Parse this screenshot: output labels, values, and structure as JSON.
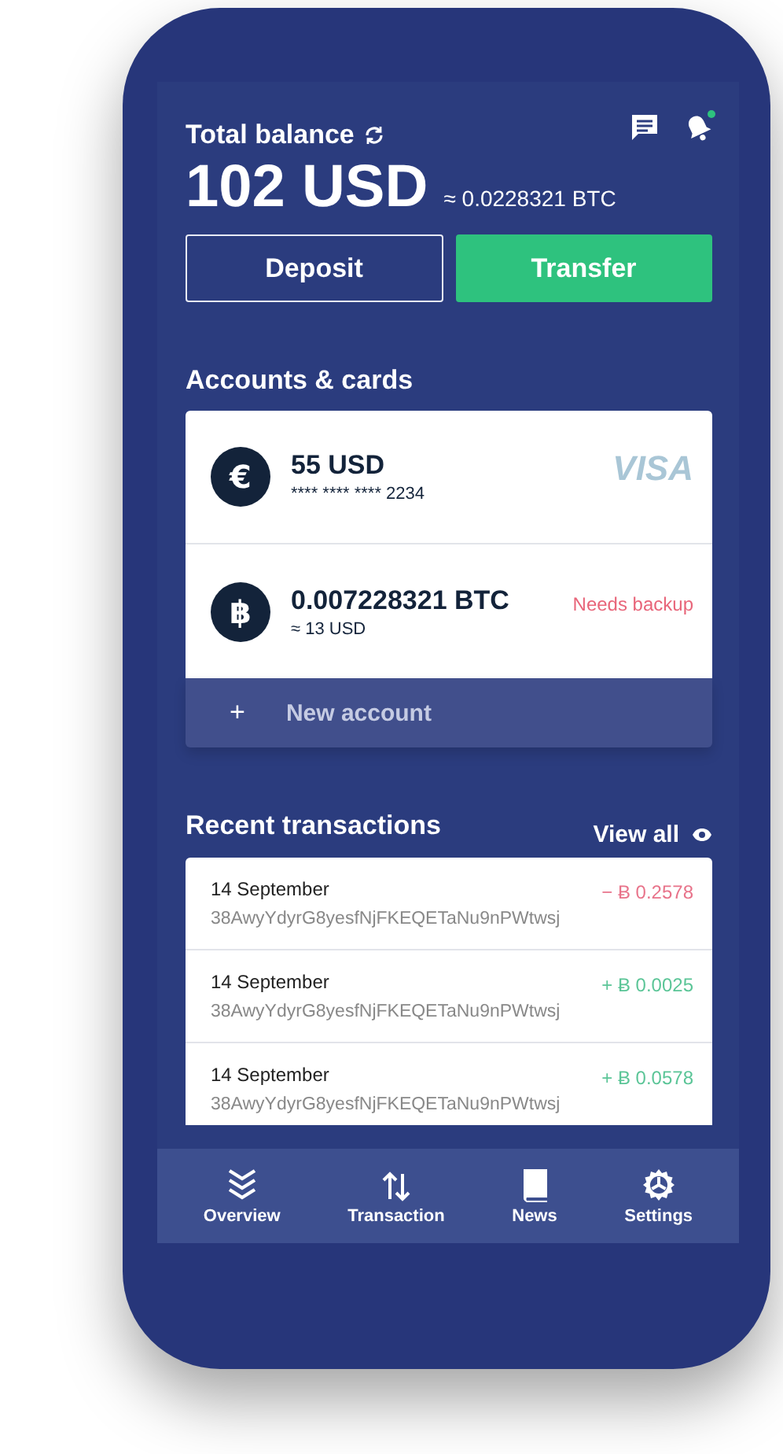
{
  "header": {
    "title": "Total balance",
    "balance": "102 USD",
    "balance_btc": "≈ 0.0228321 BTC",
    "notification_unread": true
  },
  "buttons": [
    {
      "label": "Deposit",
      "kind": "outline"
    },
    {
      "label": "Transfer",
      "kind": "primary"
    }
  ],
  "accounts": {
    "title": "Accounts & cards",
    "items": [
      {
        "symbol": "€",
        "amount": "55 USD",
        "detail": "**** **** **** 2234",
        "badge": "VISA",
        "kind": "brand"
      },
      {
        "symbol": "฿",
        "amount": "0.007228321 BTC",
        "detail": "≈ 13 USD",
        "badge": "Needs backup",
        "kind": "warning"
      }
    ],
    "new_account": {
      "icon": "+",
      "label": "New account"
    }
  },
  "transactions": {
    "title": "Recent transactions",
    "view_all": "View all",
    "items": [
      {
        "date": "14 September",
        "address": "38AwyYdyrG8yesfNjFKEQETaNu9nPWtwsj",
        "amount": "− Ƀ 0.2578",
        "kind": "out"
      },
      {
        "date": "14 September",
        "address": "38AwyYdyrG8yesfNjFKEQETaNu9nPWtwsj",
        "amount": "+ Ƀ 0.0025",
        "kind": "in"
      },
      {
        "date": "14 September",
        "address": "38AwyYdyrG8yesfNjFKEQETaNu9nPWtwsj",
        "amount": "+ Ƀ 0.0578",
        "kind": "in"
      }
    ]
  },
  "nav": [
    {
      "label": "Overview"
    },
    {
      "label": "Transaction"
    },
    {
      "label": "News"
    },
    {
      "label": "Settings"
    }
  ]
}
